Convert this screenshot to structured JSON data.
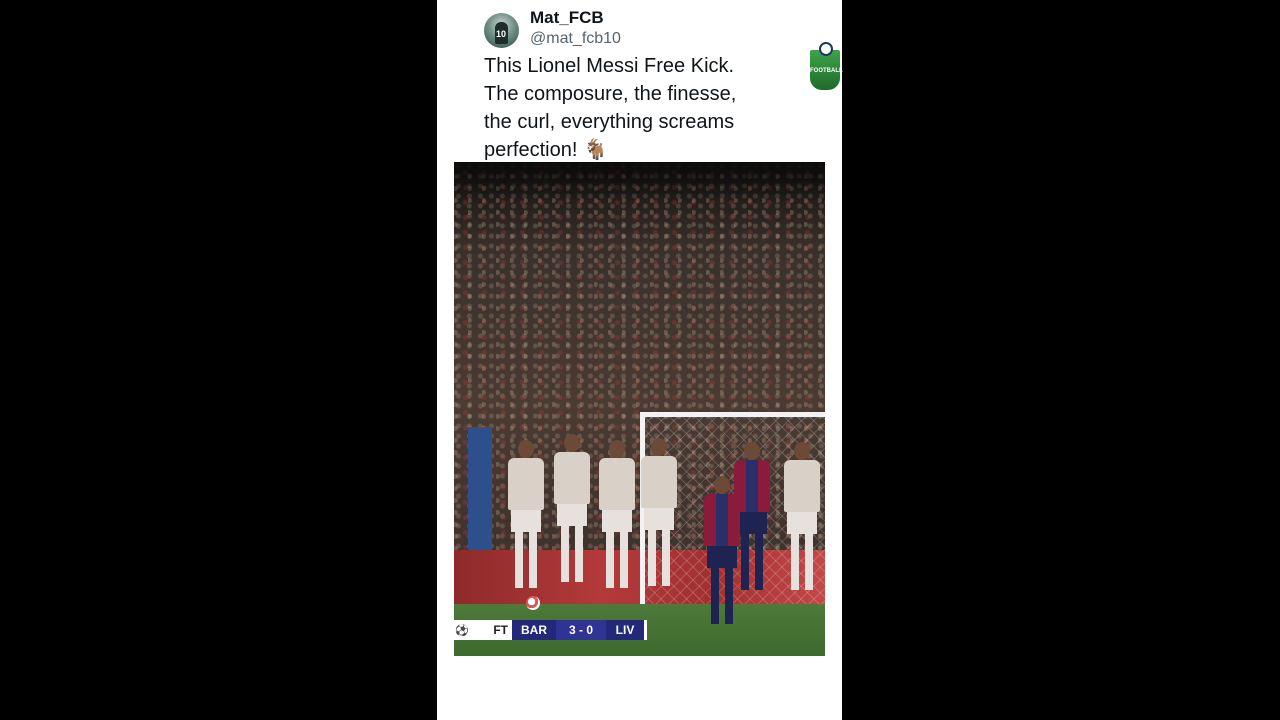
{
  "post": {
    "author_name": "Mat_FCB",
    "author_handle": "@mat_fcb10",
    "text_lines": [
      "This Lionel Messi Free Kick.",
      "The composure, the finesse,",
      "the curl, everything screams",
      "perfection! 🐐"
    ]
  },
  "video": {
    "scoreboard": {
      "status": "FT",
      "home": "BAR",
      "score": "3 - 0",
      "away": "LIV"
    },
    "badge_text": "FOOTBALL"
  },
  "colors": {
    "background": "#000000",
    "post_bg": "#ffffff",
    "scoreboard_blue": "#24287a"
  }
}
